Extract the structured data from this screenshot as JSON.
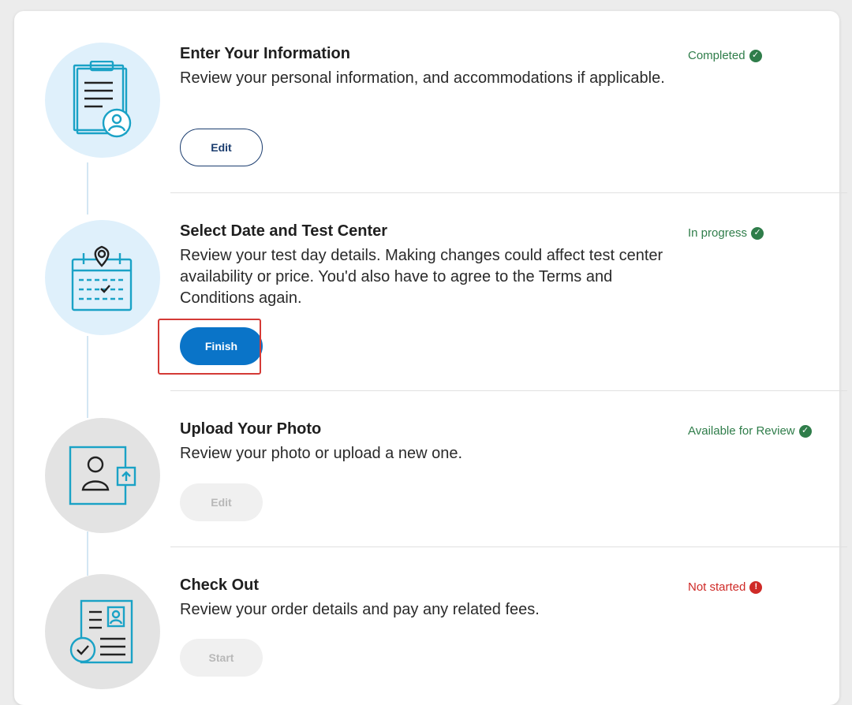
{
  "colors": {
    "completed": "#2f7d4a",
    "not_started": "#cf2a27",
    "primary_button": "#0a74c8",
    "highlight": "#d43a36"
  },
  "steps": [
    {
      "title": "Enter Your Information",
      "description": "Review your personal information, and accommodations if applicable.",
      "status": "Completed",
      "status_icon": "check-circle-icon",
      "button": "Edit",
      "button_state": "enabled",
      "icon": "clipboard-user-icon"
    },
    {
      "title": "Select Date and Test Center",
      "description": "Review your test day details. Making changes could affect test center availability or price. You'd also have to agree to the Terms and Conditions again.",
      "status": "In progress",
      "status_icon": "check-circle-icon",
      "button": "Finish",
      "button_state": "primary",
      "icon": "calendar-location-icon"
    },
    {
      "title": "Upload Your Photo",
      "description": "Review your photo or upload a new one.",
      "status": "Available for Review",
      "status_icon": "check-circle-icon",
      "button": "Edit",
      "button_state": "disabled",
      "icon": "photo-upload-icon"
    },
    {
      "title": "Check Out",
      "description": "Review your order details and pay any related fees.",
      "status": "Not started",
      "status_icon": "exclamation-circle-icon",
      "button": "Start",
      "button_state": "disabled",
      "icon": "checkout-document-icon"
    }
  ]
}
